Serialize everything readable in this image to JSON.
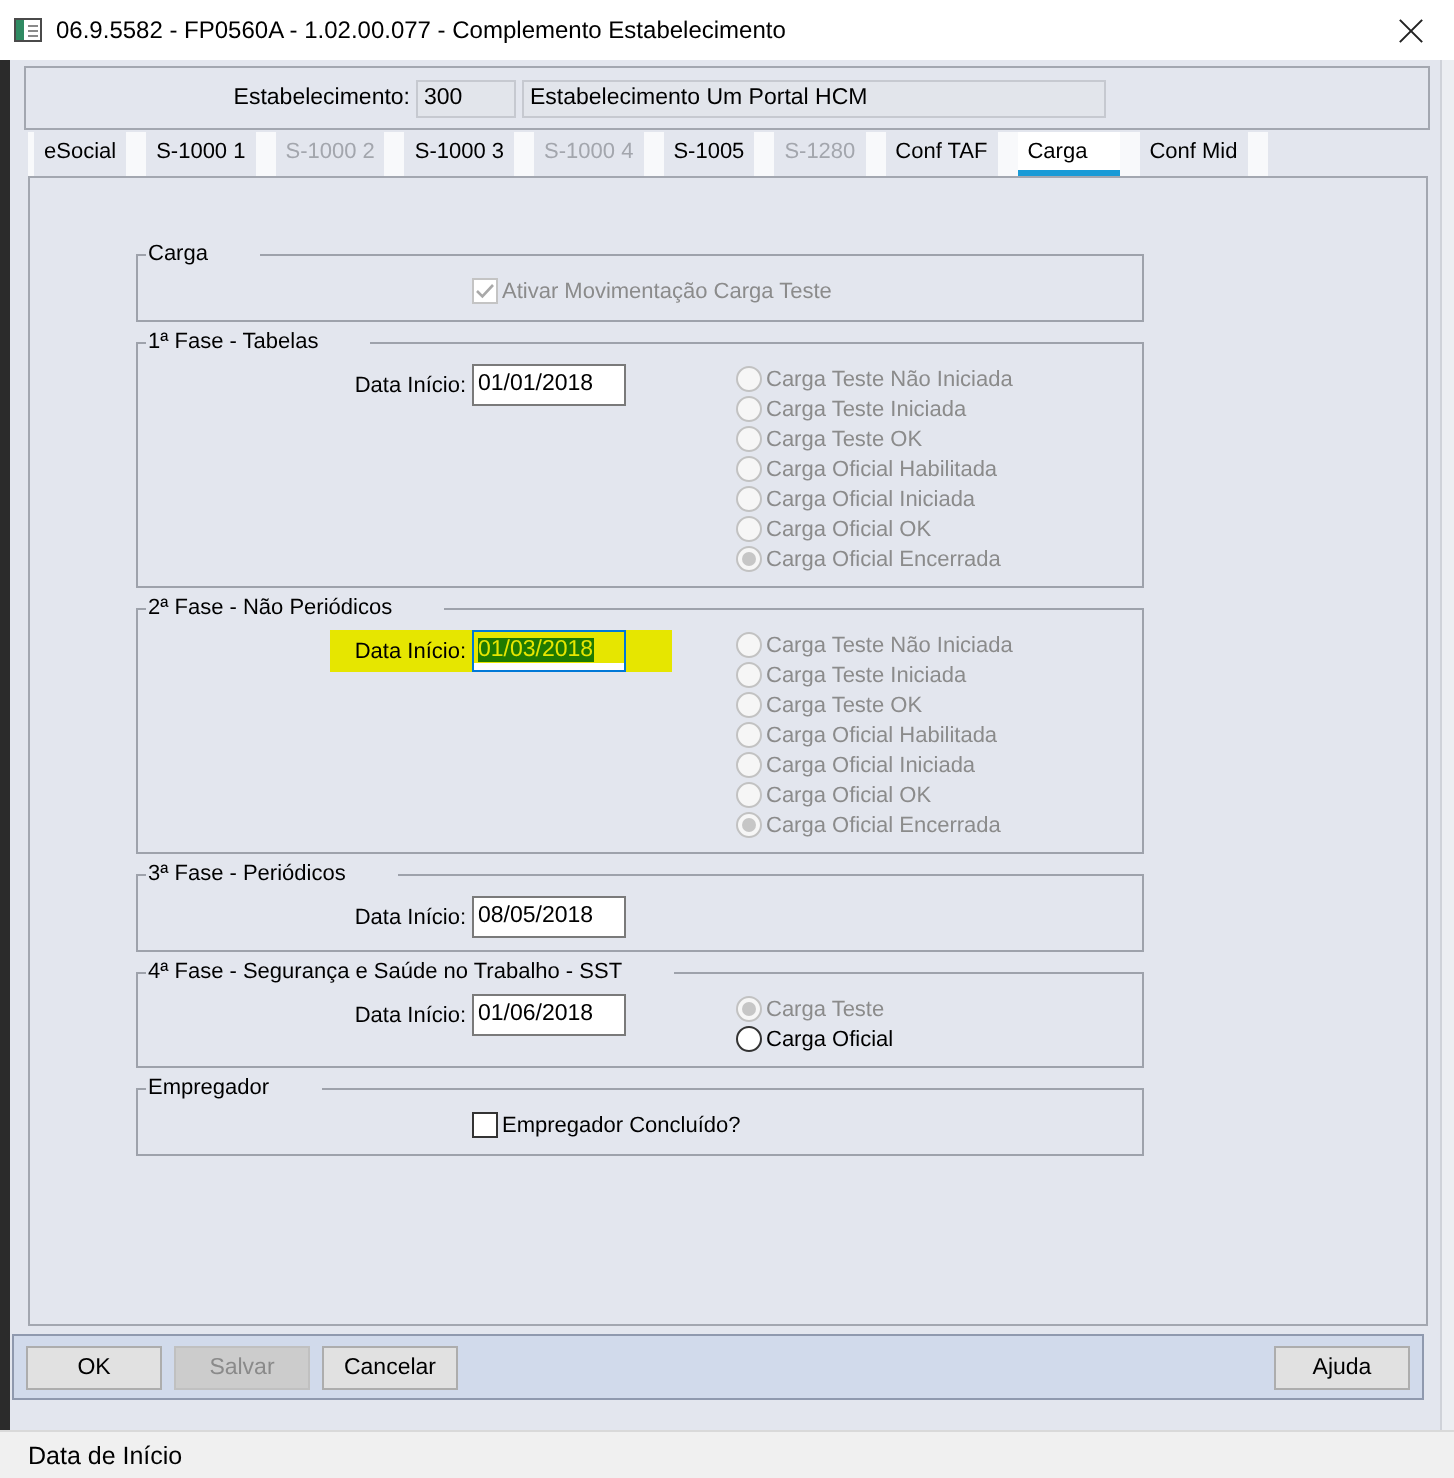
{
  "window": {
    "title": "06.9.5582 - FP0560A - 1.02.00.077 - Complemento Estabelecimento"
  },
  "header": {
    "label": "Estabelecimento:",
    "code": "300",
    "name": "Estabelecimento Um Portal HCM"
  },
  "tabs": [
    {
      "label": "eSocial",
      "selected": false,
      "disabled": false
    },
    {
      "label": "S-1000 1",
      "selected": false,
      "disabled": false
    },
    {
      "label": "S-1000 2",
      "selected": false,
      "disabled": true
    },
    {
      "label": "S-1000 3",
      "selected": false,
      "disabled": false
    },
    {
      "label": "S-1000 4",
      "selected": false,
      "disabled": true
    },
    {
      "label": "S-1005",
      "selected": false,
      "disabled": false
    },
    {
      "label": "S-1280",
      "selected": false,
      "disabled": true
    },
    {
      "label": "Conf TAF",
      "selected": false,
      "disabled": false
    },
    {
      "label": "Carga",
      "selected": true,
      "disabled": false
    },
    {
      "label": "Conf Mid",
      "selected": false,
      "disabled": false
    }
  ],
  "groups": [
    {
      "kind": "checkbox",
      "title": "Carga",
      "checkbox": {
        "label": "Ativar Movimentação Carga Teste",
        "checked": true,
        "disabled": true
      }
    },
    {
      "kind": "phase",
      "title": "1ª Fase - Tabelas",
      "date_label": "Data Início:",
      "date": "01/01/2018",
      "highlighted": false,
      "focused": false,
      "options": [
        {
          "label": "Carga Teste Não Iniciada",
          "selected": false,
          "disabled": true
        },
        {
          "label": "Carga Teste Iniciada",
          "selected": false,
          "disabled": true
        },
        {
          "label": "Carga Teste OK",
          "selected": false,
          "disabled": true
        },
        {
          "label": "Carga Oficial Habilitada",
          "selected": false,
          "disabled": true
        },
        {
          "label": "Carga Oficial Iniciada",
          "selected": false,
          "disabled": true
        },
        {
          "label": "Carga Oficial OK",
          "selected": false,
          "disabled": true
        },
        {
          "label": "Carga Oficial Encerrada",
          "selected": true,
          "disabled": true
        }
      ]
    },
    {
      "kind": "phase",
      "title": "2ª Fase - Não Periódicos",
      "date_label": "Data Início:",
      "date": "01/03/2018",
      "highlighted": true,
      "focused": true,
      "options": [
        {
          "label": "Carga Teste Não Iniciada",
          "selected": false,
          "disabled": true
        },
        {
          "label": "Carga Teste Iniciada",
          "selected": false,
          "disabled": true
        },
        {
          "label": "Carga Teste OK",
          "selected": false,
          "disabled": true
        },
        {
          "label": "Carga Oficial Habilitada",
          "selected": false,
          "disabled": true
        },
        {
          "label": "Carga Oficial Iniciada",
          "selected": false,
          "disabled": true
        },
        {
          "label": "Carga Oficial OK",
          "selected": false,
          "disabled": true
        },
        {
          "label": "Carga Oficial Encerrada",
          "selected": true,
          "disabled": true
        }
      ]
    },
    {
      "kind": "phase",
      "title": "3ª Fase - Periódicos",
      "date_label": "Data Início:",
      "date": "08/05/2018",
      "highlighted": false,
      "focused": false
    },
    {
      "kind": "phase",
      "title": "4ª Fase - Segurança e Saúde no Trabalho - SST",
      "date_label": "Data Início:",
      "date": "01/06/2018",
      "highlighted": false,
      "focused": false,
      "options": [
        {
          "label": "Carga Teste",
          "selected": true,
          "disabled": true
        },
        {
          "label": "Carga Oficial",
          "selected": false,
          "disabled": false
        }
      ]
    },
    {
      "kind": "checkbox",
      "title": "Empregador",
      "checkbox": {
        "label": "Empregador Concluído?",
        "checked": false,
        "disabled": false
      }
    }
  ],
  "buttons": [
    {
      "label": "OK",
      "disabled": false
    },
    {
      "label": "Salvar",
      "disabled": true
    },
    {
      "label": "Cancelar",
      "disabled": false
    }
  ],
  "help_button": {
    "label": "Ajuda",
    "disabled": false
  },
  "status_bar": {
    "text": "Data de Início"
  }
}
